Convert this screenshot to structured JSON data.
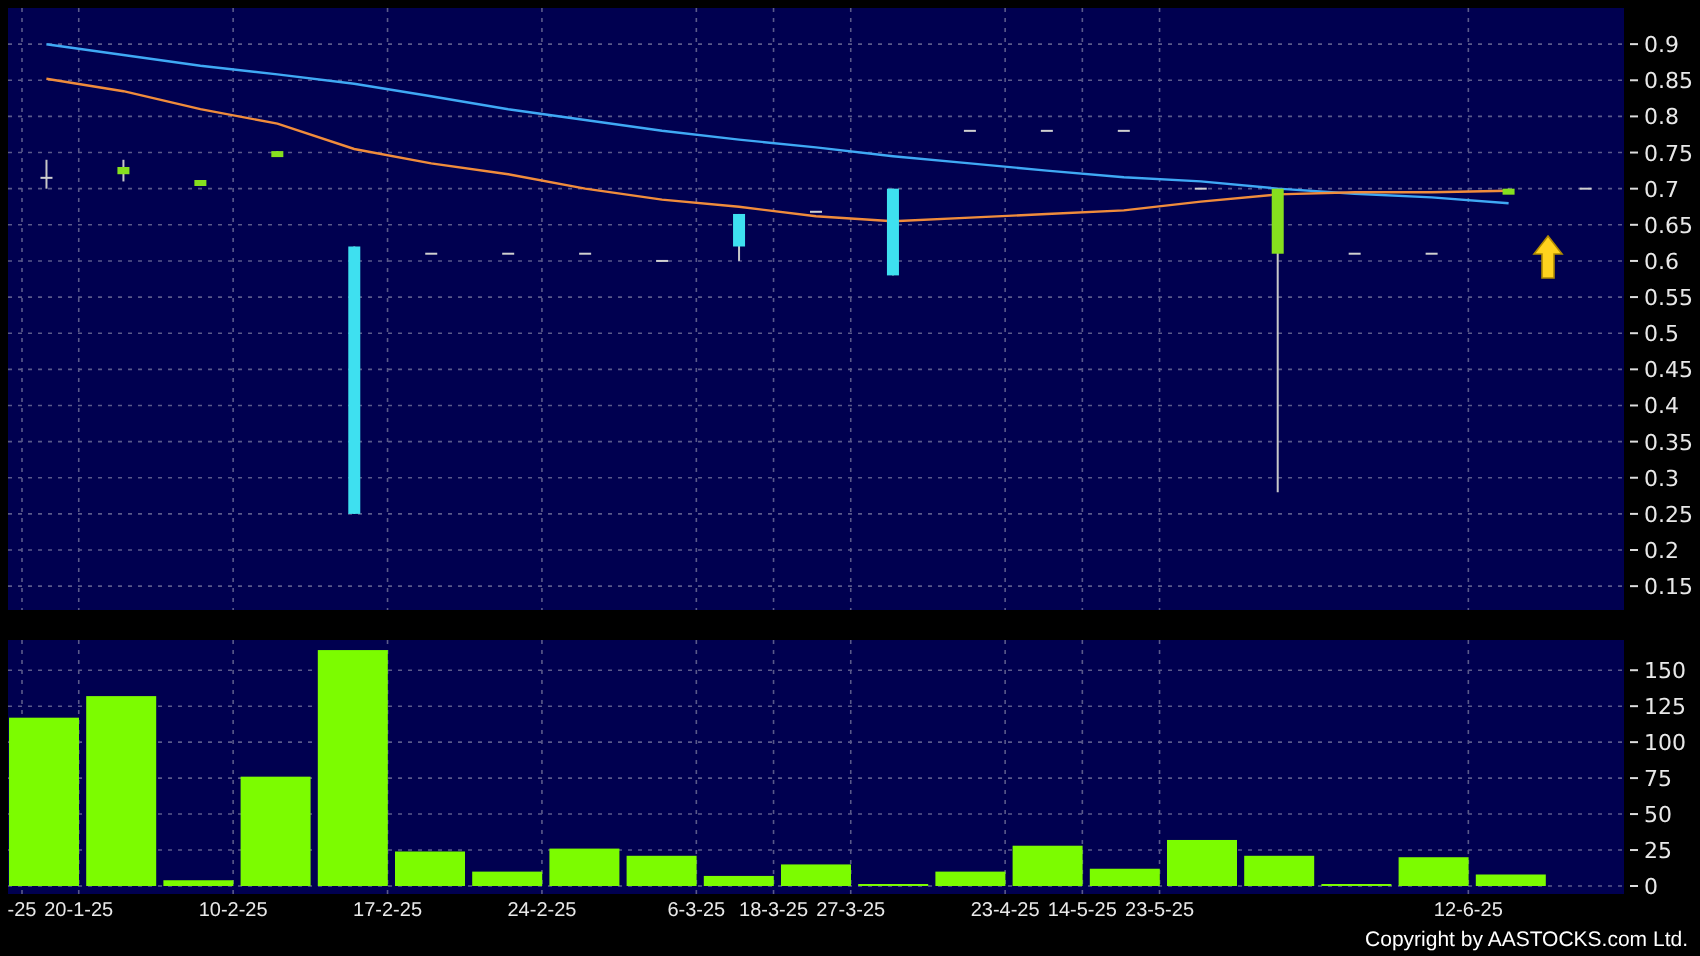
{
  "price_panel": {
    "chart_data": {
      "type": "line",
      "grid": true,
      "series": [
        {
          "color": "#3fa9f5",
          "values": [
            0.9,
            0.885,
            0.87,
            0.858,
            0.845,
            0.828,
            0.81,
            0.795,
            0.78,
            0.768,
            0.757,
            0.745,
            0.735,
            0.725,
            0.716,
            0.71,
            0.7,
            0.693,
            0.688,
            0.68,
            null
          ]
        },
        {
          "color": "#f08c3c",
          "values": [
            0.852,
            0.835,
            0.81,
            0.79,
            0.755,
            0.735,
            0.72,
            0.7,
            0.685,
            0.675,
            0.662,
            0.655,
            0.66,
            0.665,
            0.67,
            0.682,
            0.692,
            0.695,
            0.695,
            0.697,
            null
          ]
        }
      ],
      "ylim": [
        0.117,
        0.95
      ],
      "yticks": [
        0.9,
        0.85,
        0.8,
        0.75,
        0.7,
        0.65,
        0.6,
        0.55,
        0.5,
        0.45,
        0.4,
        0.35,
        0.3,
        0.25,
        0.2,
        0.15
      ]
    }
  },
  "volume_panel": {
    "chart_data": {
      "type": "bar",
      "grid": true,
      "categories": [
        "-25",
        "20-1-25",
        null,
        "10-2-25",
        null,
        "17-2-25",
        null,
        "24-2-25",
        null,
        "6-3-25",
        "18-3-25",
        "27-3-25",
        null,
        "23-4-25",
        "14-5-25",
        "23-5-25",
        null,
        null,
        null,
        "12-6-25",
        null,
        null
      ],
      "values": [
        null,
        117,
        132,
        4,
        76,
        164,
        24,
        10,
        26,
        21,
        7,
        15,
        1,
        10,
        28,
        12,
        32,
        21,
        1,
        20,
        8,
        null
      ],
      "ylim": [
        0,
        171
      ],
      "yticks": [
        150,
        125,
        100,
        75,
        50,
        25,
        0
      ]
    }
  },
  "copyright": "Copyright by AASTOCKS.com Ltd."
}
